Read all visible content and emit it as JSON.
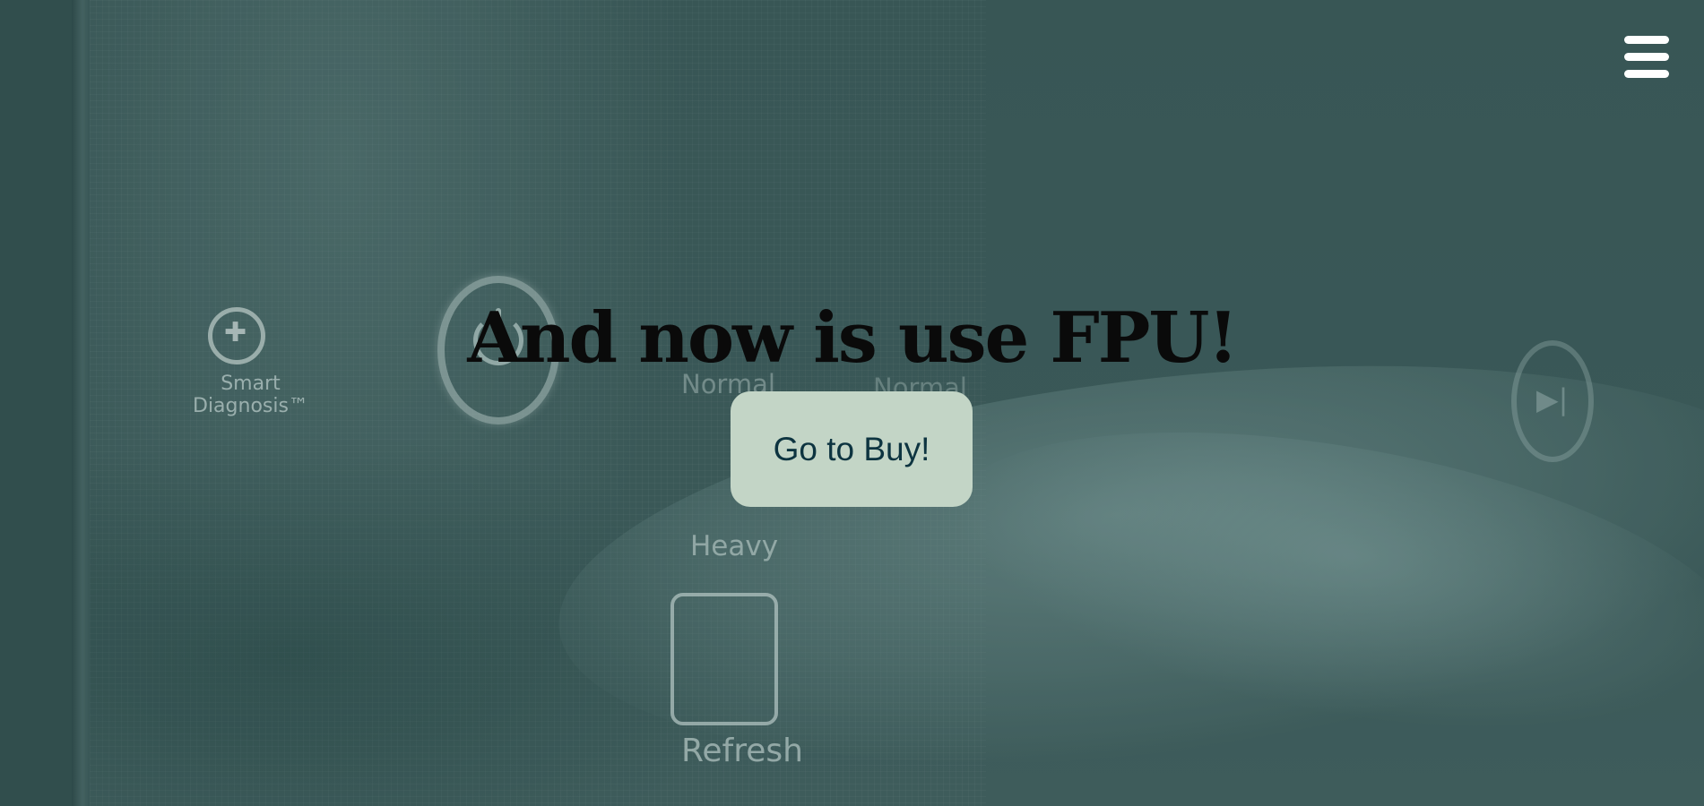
{
  "hero": {
    "headline": "And now is use FPU!",
    "cta_label": "Go to Buy!",
    "background_labels": {
      "smart_diagnosis": "Smart\nDiagnosis™",
      "normal_1": "Normal",
      "normal_2": "Normal",
      "heavy": "Heavy",
      "refresh": "Refresh"
    }
  },
  "header": {
    "menu_icon": "hamburger-menu-icon"
  },
  "colors": {
    "background_tint": "#3f5b5a",
    "button_bg": "#c3d5c6",
    "button_text": "#0d3440",
    "headline_text": "#0a0a0a",
    "menu_icon": "#ffffff"
  }
}
